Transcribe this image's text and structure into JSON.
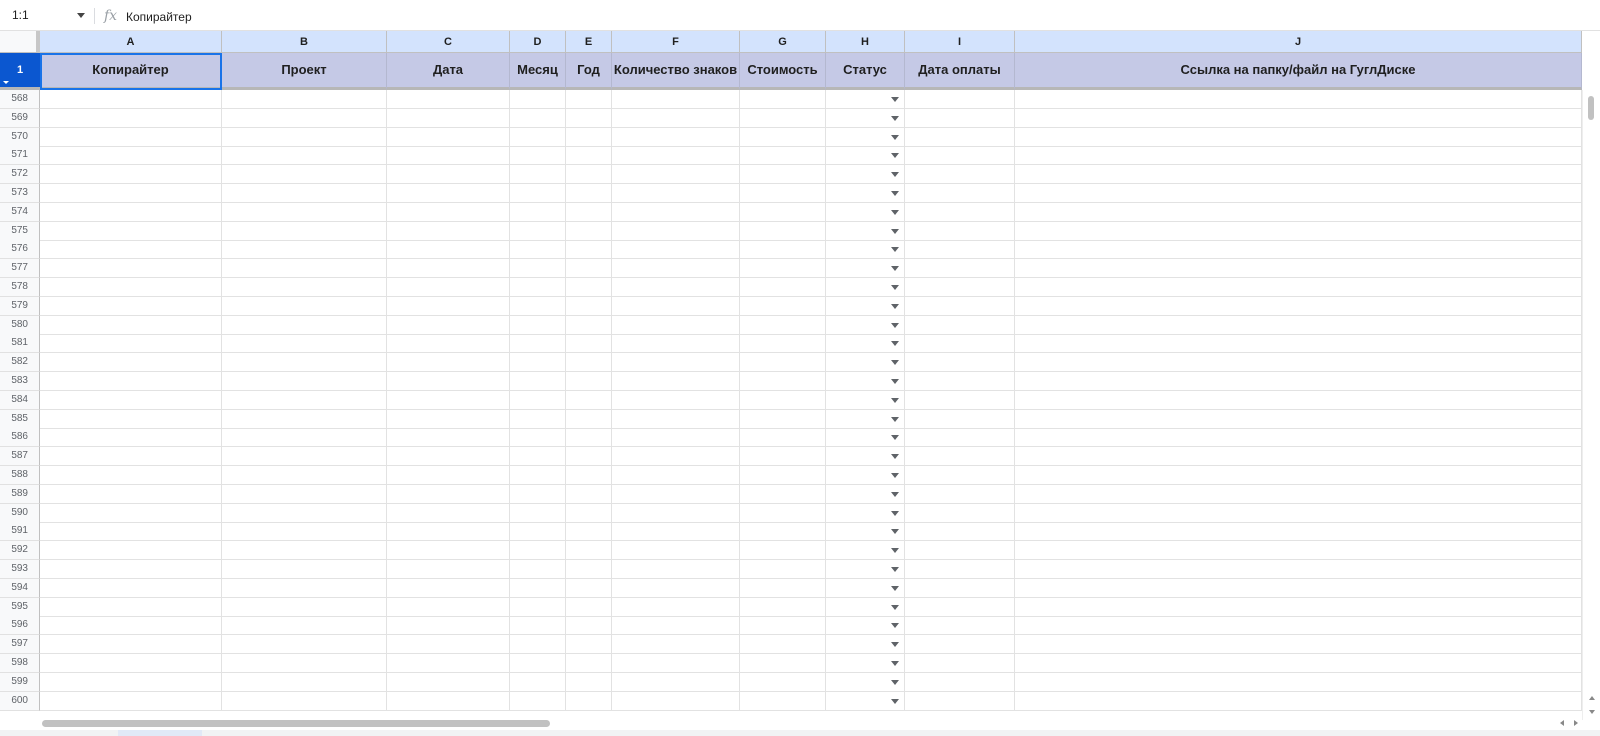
{
  "formula_bar": {
    "name_box": "1:1",
    "fx": "fx",
    "content": "Копирайтер"
  },
  "columns": [
    {
      "letter": "A",
      "header": "Копирайтер"
    },
    {
      "letter": "B",
      "header": "Проект"
    },
    {
      "letter": "C",
      "header": "Дата"
    },
    {
      "letter": "D",
      "header": "Месяц"
    },
    {
      "letter": "E",
      "header": "Год"
    },
    {
      "letter": "F",
      "header": "Количество знаков"
    },
    {
      "letter": "G",
      "header": "Стоимость"
    },
    {
      "letter": "H",
      "header": "Статус"
    },
    {
      "letter": "I",
      "header": "Дата оплаты"
    },
    {
      "letter": "J",
      "header": "Ссылка на папку/файл на ГуглДиске"
    }
  ],
  "frozen_row_number": "1",
  "row_numbers": [
    "568",
    "569",
    "570",
    "571",
    "572",
    "573",
    "574",
    "575",
    "576",
    "577",
    "578",
    "579",
    "580",
    "581",
    "582",
    "583",
    "584",
    "585",
    "586",
    "587",
    "588",
    "589",
    "590",
    "591",
    "592",
    "593",
    "594",
    "595",
    "596",
    "597",
    "598",
    "599",
    "600"
  ],
  "dropdown_column": "H"
}
